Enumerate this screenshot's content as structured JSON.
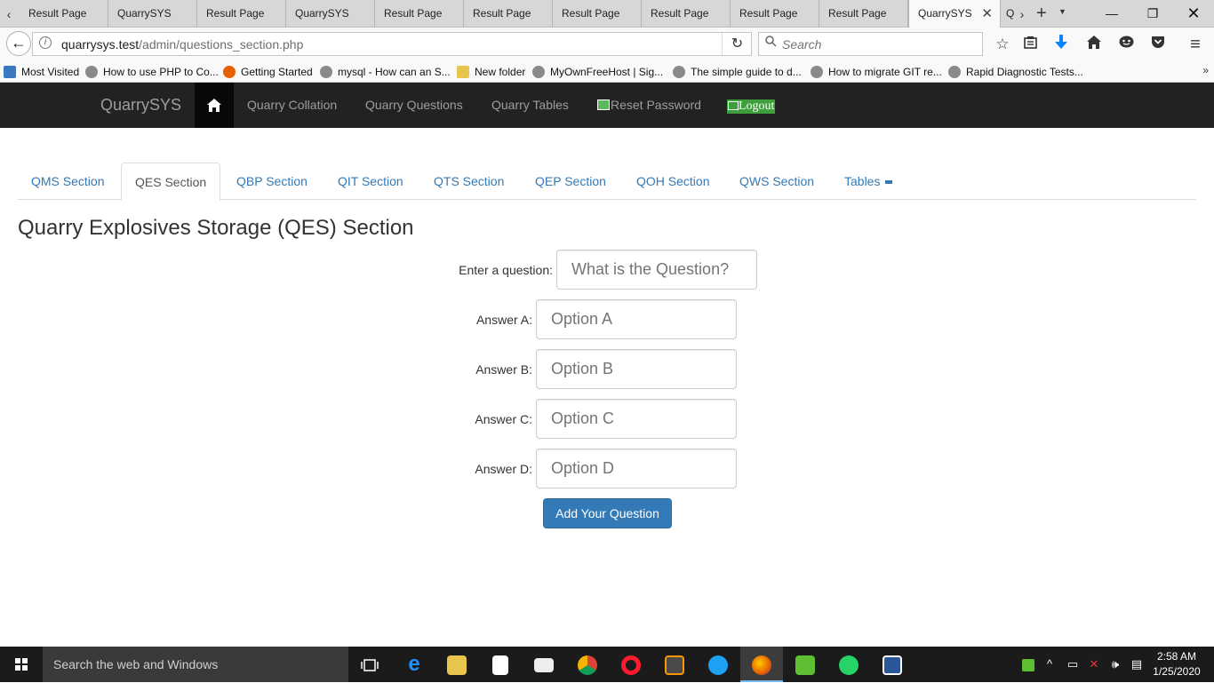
{
  "browser": {
    "tabs": [
      {
        "label": "Result Page"
      },
      {
        "label": "QuarrySYS"
      },
      {
        "label": "Result Page"
      },
      {
        "label": "QuarrySYS"
      },
      {
        "label": "Result Page"
      },
      {
        "label": "Result Page"
      },
      {
        "label": "Result Page"
      },
      {
        "label": "Result Page"
      },
      {
        "label": "Result Page"
      },
      {
        "label": "Result Page"
      },
      {
        "label": "QuarrySYS",
        "active": true
      },
      {
        "label": "Q"
      }
    ],
    "url_host": "quarrysys.test",
    "url_path": "/admin/questions_section.php",
    "search_placeholder": "Search",
    "bookmarks": [
      {
        "label": "Most Visited",
        "color": "#3b78c2"
      },
      {
        "label": "How to use PHP to Co...",
        "color": "#8a8a8a"
      },
      {
        "label": "Getting Started",
        "color": "#e66000"
      },
      {
        "label": "mysql - How can an S...",
        "color": "#8a8a8a"
      },
      {
        "label": "New folder",
        "color": "#e8c54d"
      },
      {
        "label": "MyOwnFreeHost | Sig...",
        "color": "#8a8a8a"
      },
      {
        "label": "The simple guide to d...",
        "color": "#8a8a8a"
      },
      {
        "label": "How to migrate GIT re...",
        "color": "#8a8a8a"
      },
      {
        "label": "Rapid Diagnostic Tests...",
        "color": "#8a8a8a"
      }
    ]
  },
  "site_nav": {
    "brand": "QuarrySYS",
    "links": [
      {
        "label": "Quarry Collation"
      },
      {
        "label": "Quarry Questions"
      },
      {
        "label": "Quarry Tables"
      }
    ],
    "reset_password": "Reset Password",
    "logout": "Logout"
  },
  "section_tabs": [
    {
      "label": "QMS Section"
    },
    {
      "label": "QES Section",
      "active": true
    },
    {
      "label": "QBP Section"
    },
    {
      "label": "QIT Section"
    },
    {
      "label": "QTS Section"
    },
    {
      "label": "QEP Section"
    },
    {
      "label": "QOH Section"
    },
    {
      "label": "QWS Section"
    },
    {
      "label": "Tables"
    }
  ],
  "page": {
    "title": "Quarry Explosives Storage (QES) Section",
    "question_label": "Enter a question:",
    "question_placeholder": "What is the Question?",
    "answers": [
      {
        "label": "Answer A:",
        "placeholder": "Option A"
      },
      {
        "label": "Answer B:",
        "placeholder": "Option B"
      },
      {
        "label": "Answer C:",
        "placeholder": "Option C"
      },
      {
        "label": "Answer D:",
        "placeholder": "Option D"
      }
    ],
    "submit_label": "Add Your Question"
  },
  "taskbar": {
    "search_text": "Search the web and Windows",
    "time": "2:58 AM",
    "date": "1/25/2020"
  },
  "colors": {
    "nav_bg": "#222222",
    "link_blue": "#337ab7",
    "button_blue": "#337ab7",
    "logout_green": "#3c9f3c"
  }
}
